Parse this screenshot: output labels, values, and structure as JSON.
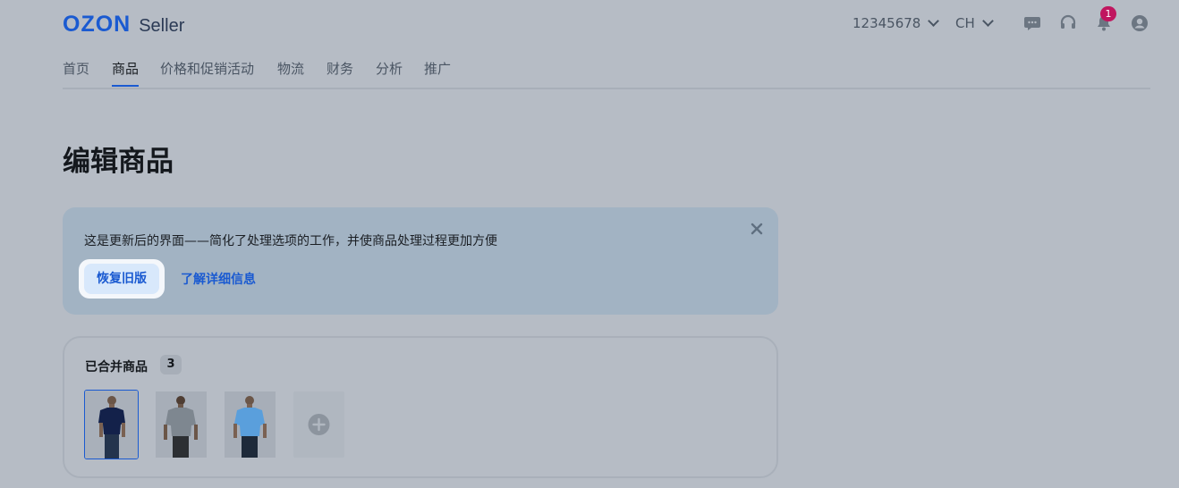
{
  "header": {
    "logo_ozon": "OZON",
    "logo_seller": "Seller",
    "account_id": "12345678",
    "language": "CH",
    "notification_count": "1",
    "icons": [
      "chat-icon",
      "headset-icon",
      "bell-icon",
      "user-icon"
    ]
  },
  "nav": {
    "items": [
      {
        "label": "首页"
      },
      {
        "label": "商品"
      },
      {
        "label": "价格和促销活动"
      },
      {
        "label": "物流"
      },
      {
        "label": "财务"
      },
      {
        "label": "分析"
      },
      {
        "label": "推广"
      }
    ],
    "active": "商品"
  },
  "page": {
    "title": "编辑商品"
  },
  "banner": {
    "message": "这是更新后的界面——简化了处理选项的工作，并使商品处理过程更加方便",
    "restore_label": "恢复旧版",
    "learn_more_label": "了解详细信息"
  },
  "merged": {
    "title": "已合并商品",
    "count": "3",
    "variants": [
      {
        "color": "#13214a",
        "selected": true
      },
      {
        "color": "#7e8790",
        "selected": false
      },
      {
        "color": "#5a9fdc",
        "selected": false
      }
    ]
  },
  "colors": {
    "accent": "#1a5ad1",
    "badge": "#c0165f",
    "overlay_background": "#b6bcc5"
  }
}
